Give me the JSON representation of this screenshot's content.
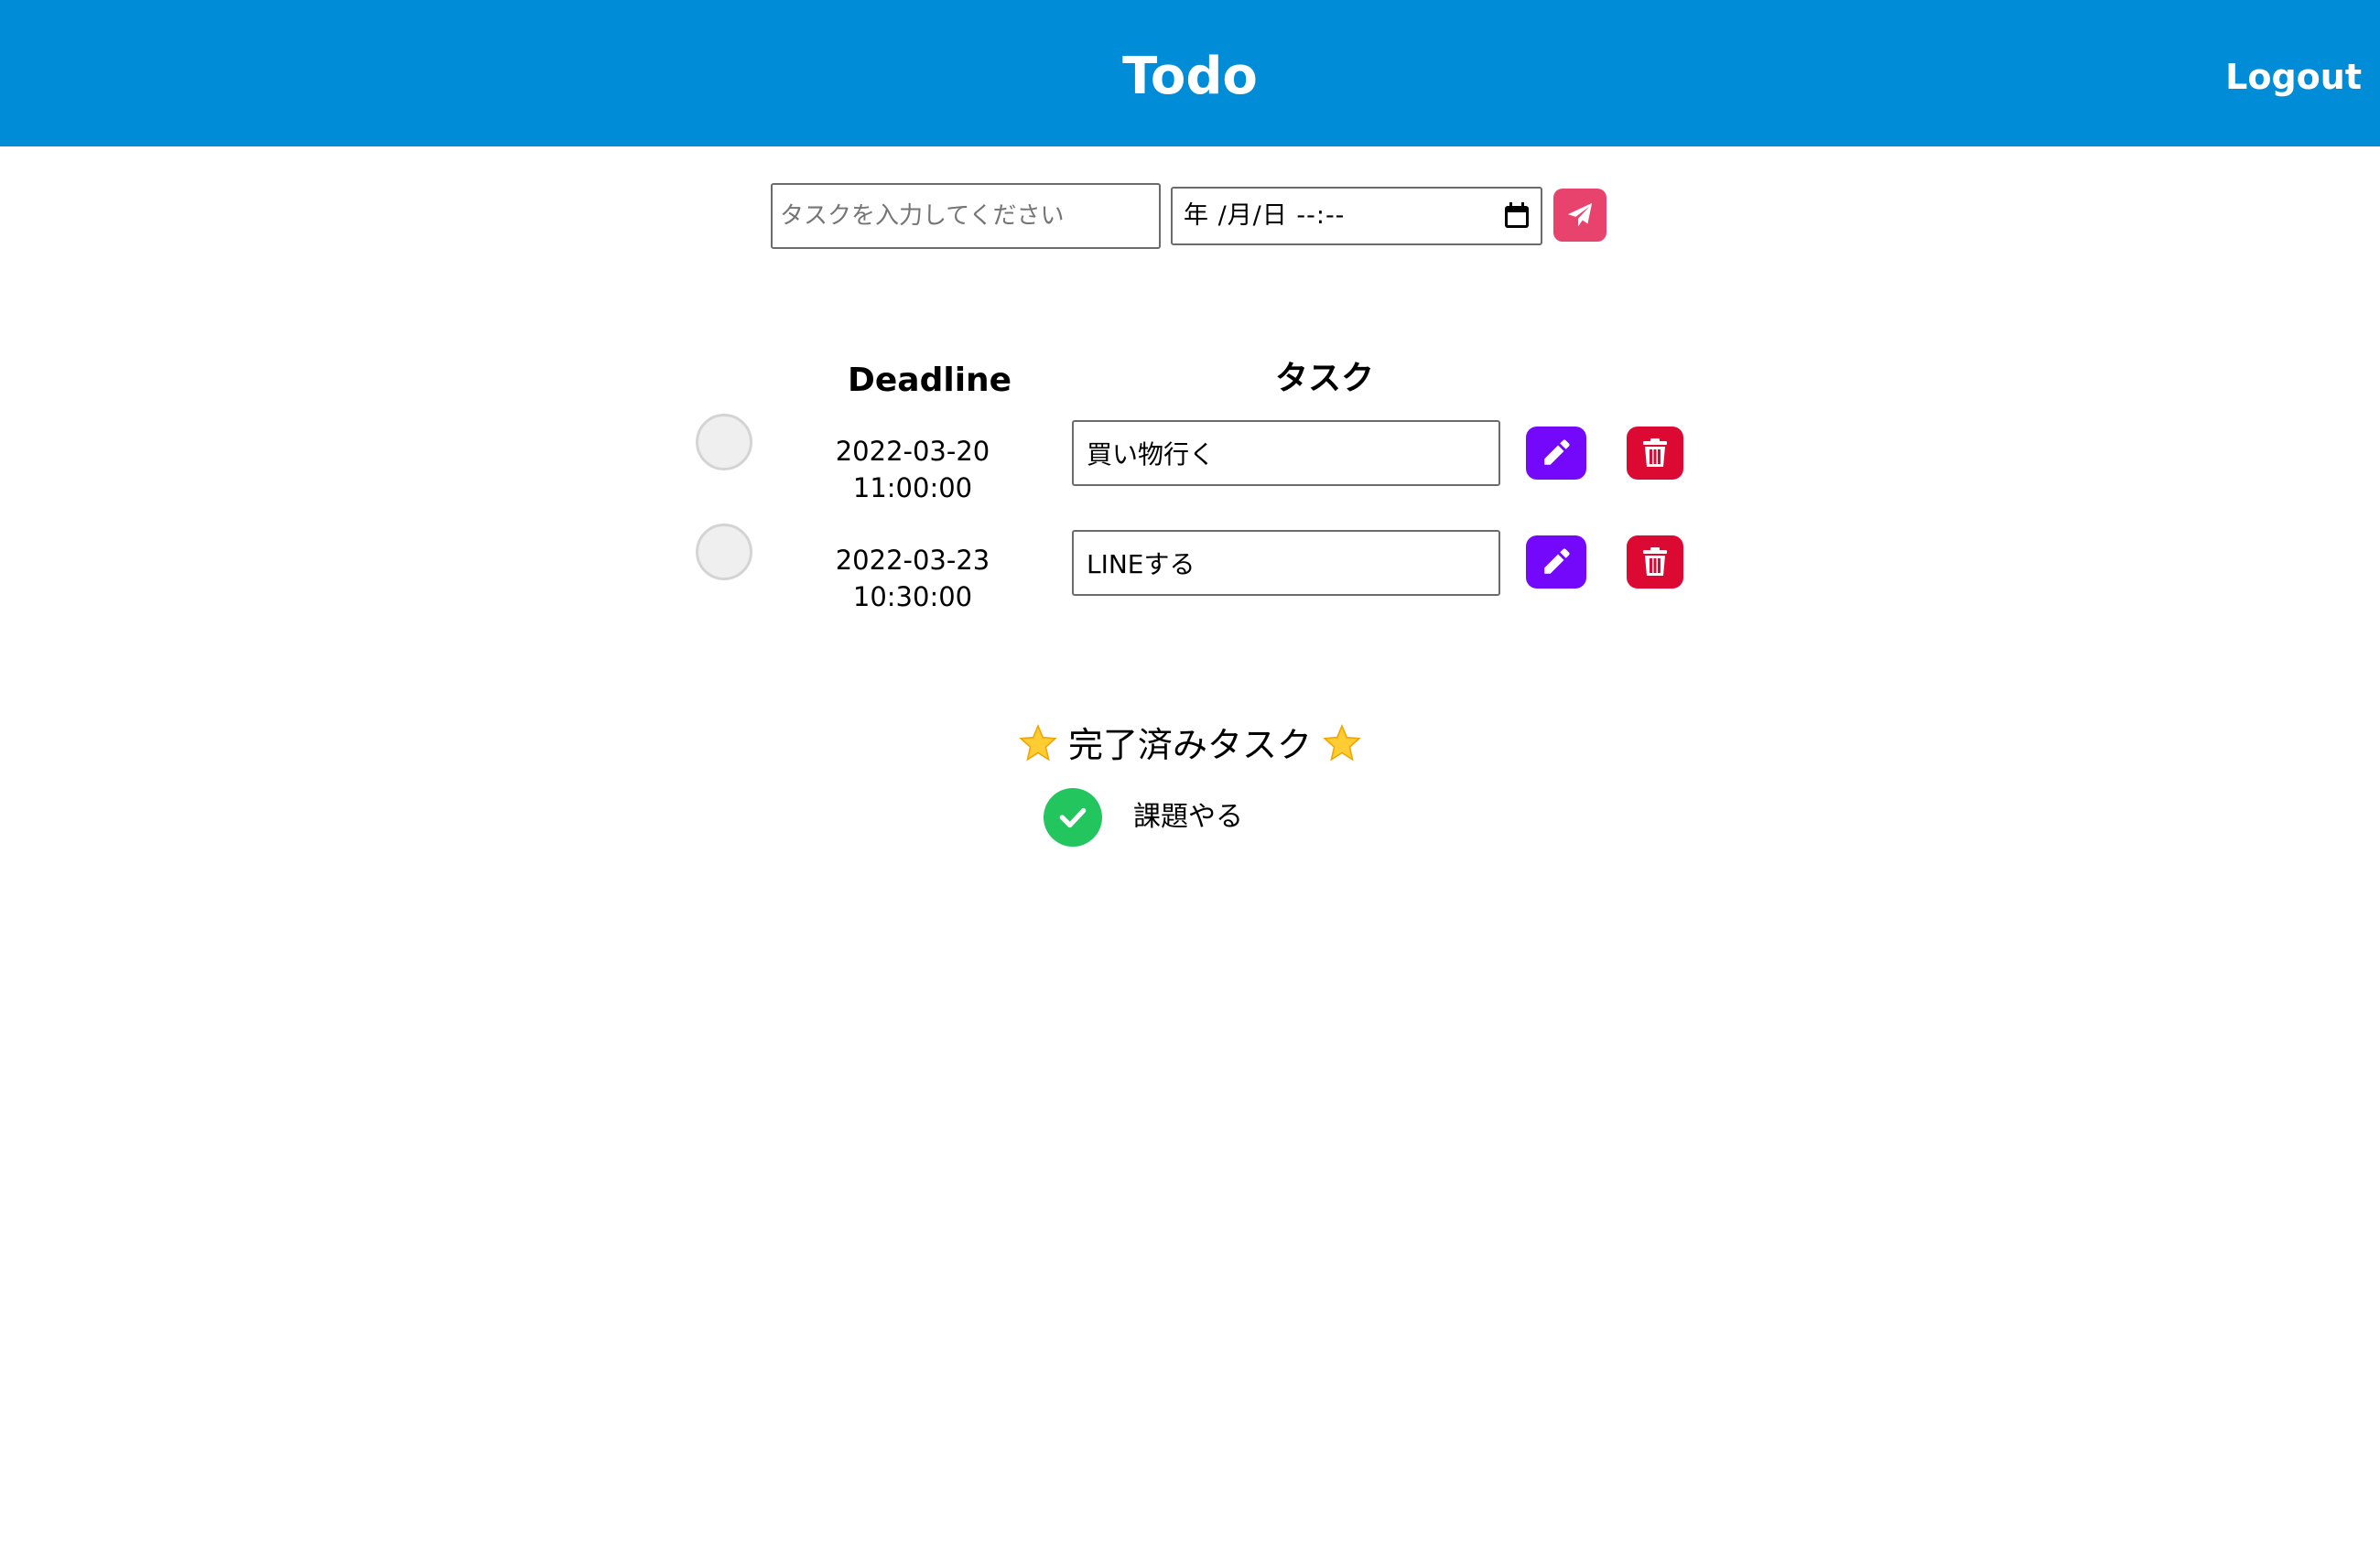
{
  "header": {
    "title": "Todo",
    "logout_label": "Logout",
    "background_color": "#008cd6"
  },
  "form": {
    "task_placeholder": "タスクを入力してください",
    "task_value": "",
    "datetime_display": "年 /月/日 --:--",
    "calendar_icon": "calendar-icon",
    "send_icon": "paper-plane-icon",
    "send_button_color": "#e8436c"
  },
  "columns": {
    "deadline": "Deadline",
    "task": "タスク"
  },
  "tasks": [
    {
      "deadline": "2022-03-20 11:00:00",
      "task": "買い物行く",
      "completed": false
    },
    {
      "deadline": "2022-03-23 10:30:00",
      "task": "LINEする",
      "completed": false
    }
  ],
  "actions": {
    "edit_icon": "pencil-icon",
    "edit_color": "#7308fa",
    "delete_icon": "trash-icon",
    "delete_color": "#dc0a33"
  },
  "completed": {
    "heading": "完了済みタスク",
    "heading_icon": "star-icon",
    "items": [
      {
        "task": "課題やる",
        "icon": "check-circle-icon",
        "color": "#22c55e"
      }
    ]
  }
}
